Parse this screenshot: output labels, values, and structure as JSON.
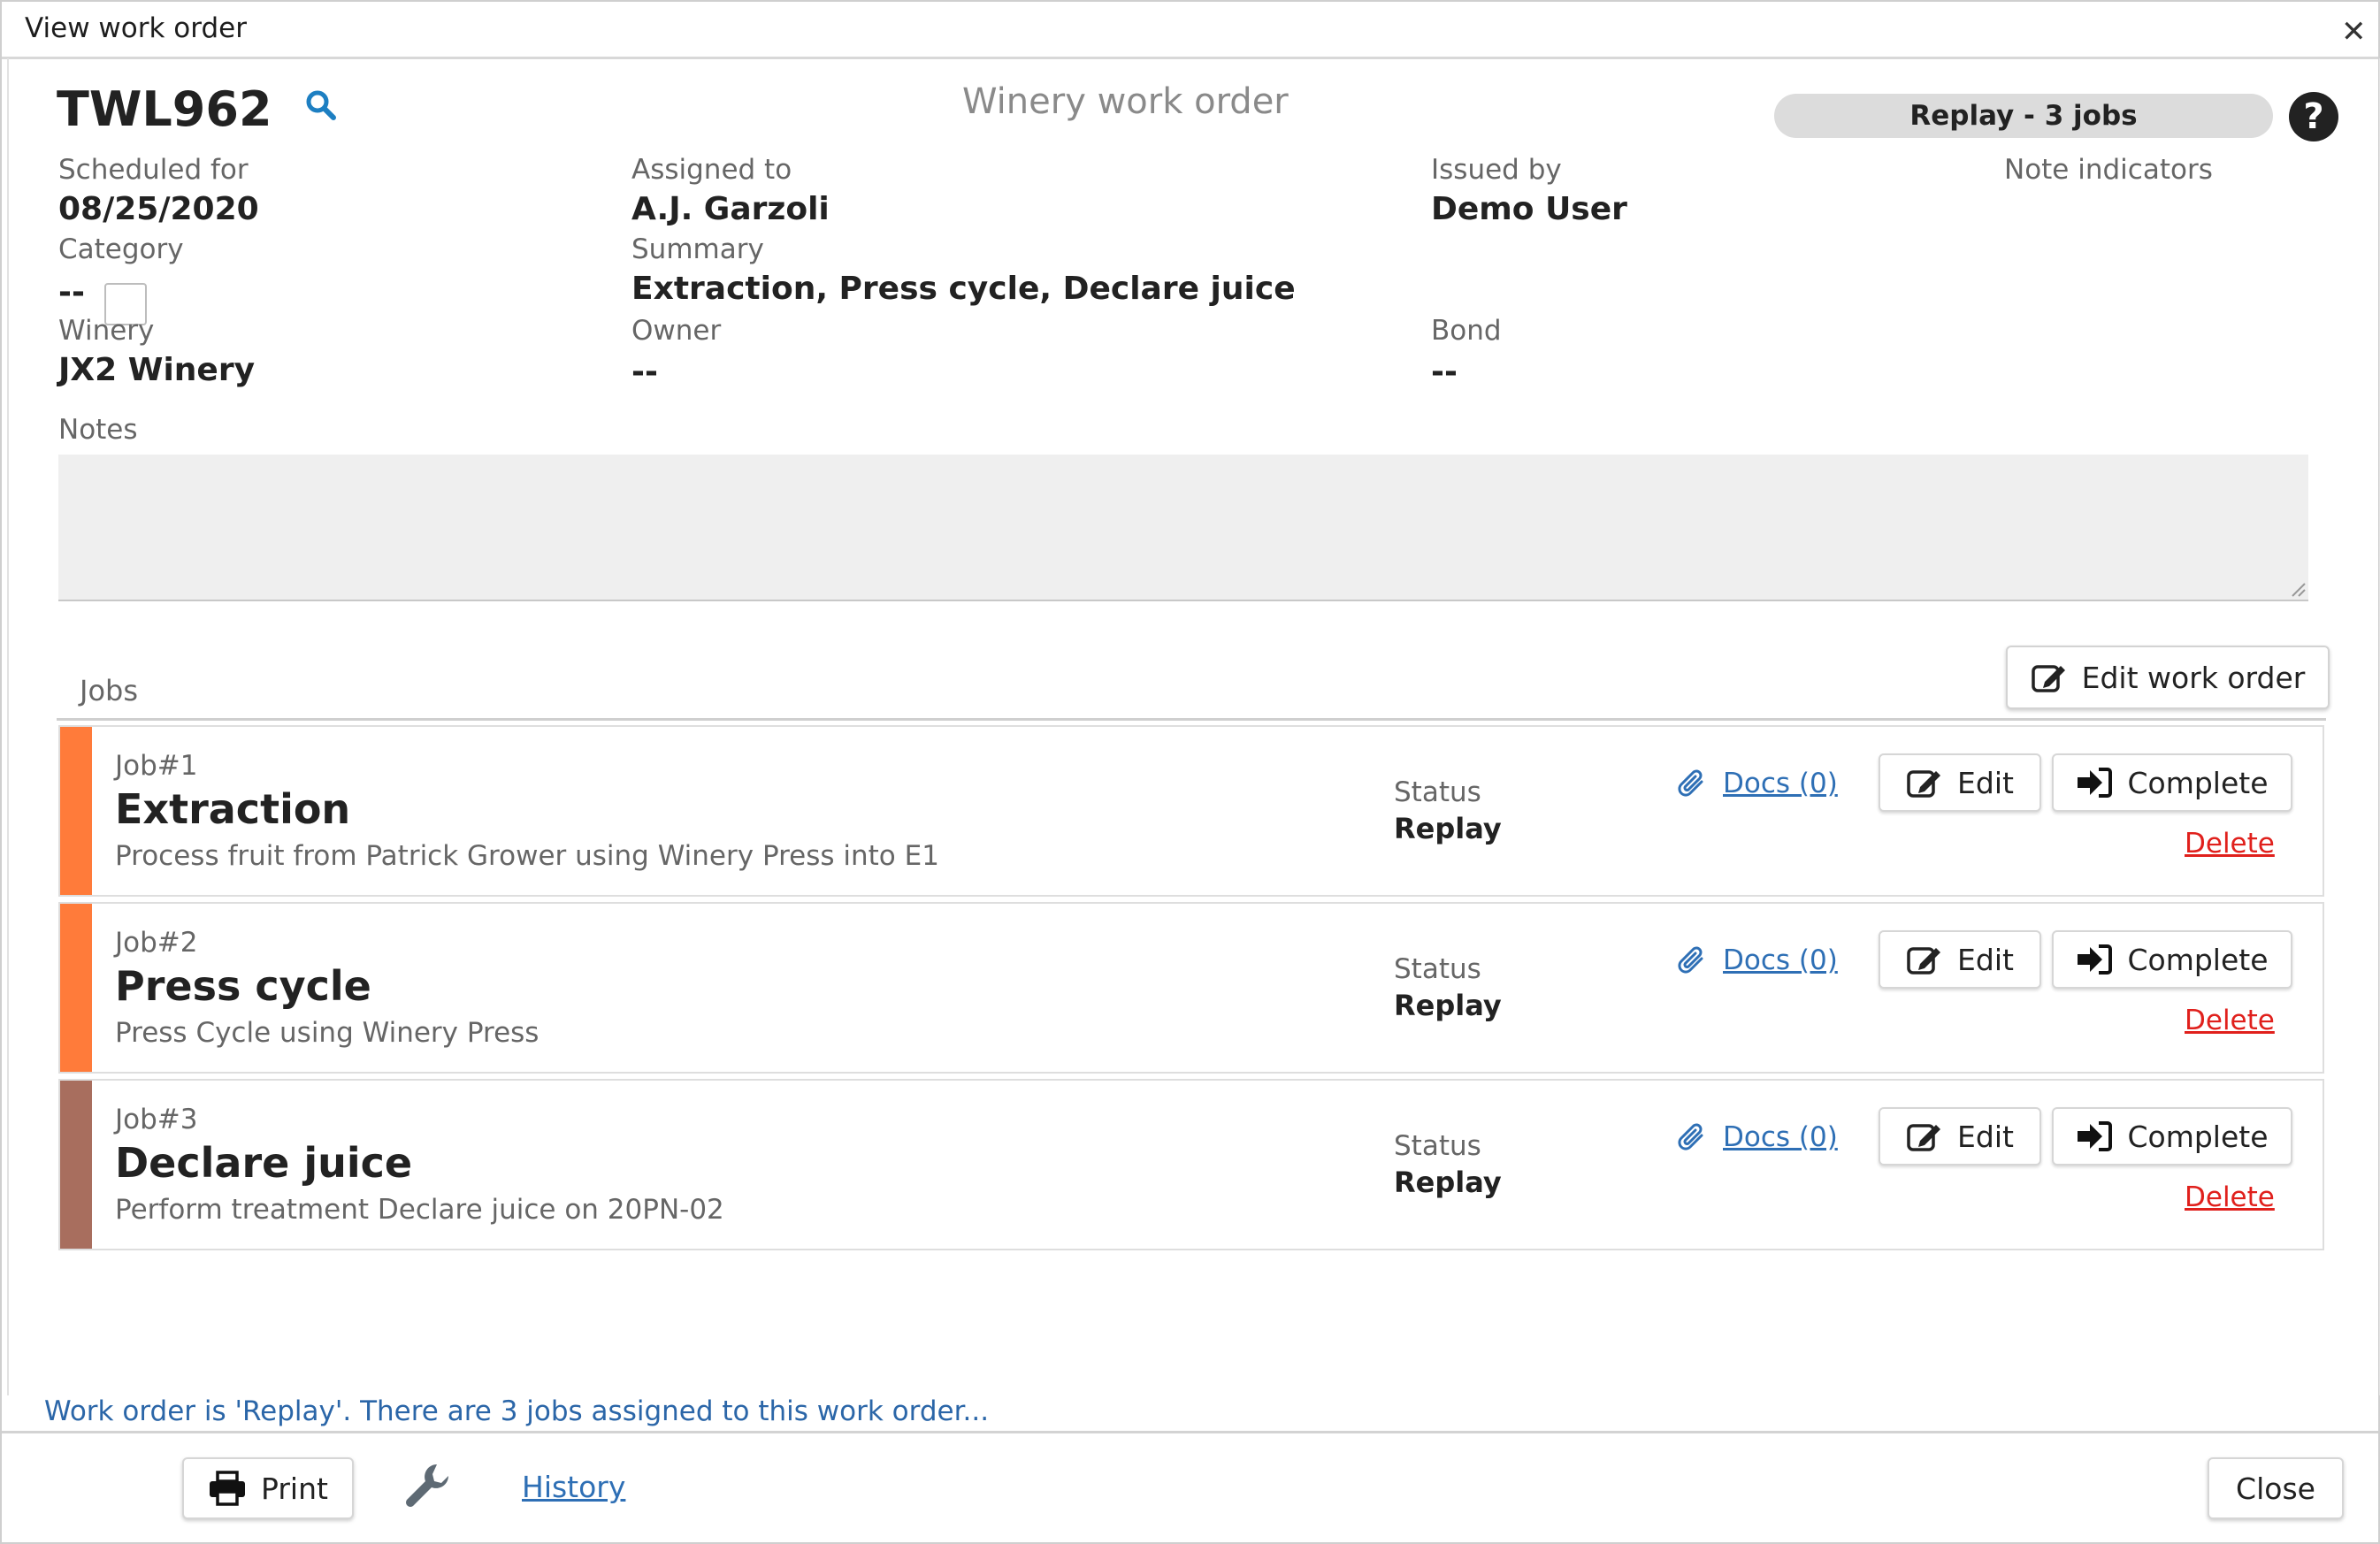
{
  "window": {
    "title": "View work order",
    "close_icon": "close-icon"
  },
  "header": {
    "work_order_number": "TWL962",
    "work_order_type": "Winery work order",
    "status_pill": "Replay - 3 jobs"
  },
  "fields": {
    "scheduled_for": {
      "label": "Scheduled for",
      "value": "08/25/2020"
    },
    "assigned_to": {
      "label": "Assigned to",
      "value": "A.J. Garzoli"
    },
    "issued_by": {
      "label": "Issued by",
      "value": "Demo User"
    },
    "note_indicators": {
      "label": "Note indicators"
    },
    "category": {
      "label": "Category",
      "value": "--"
    },
    "summary": {
      "label": "Summary",
      "value": "Extraction, Press cycle, Declare juice"
    },
    "winery": {
      "label": "Winery",
      "value": "JX2 Winery"
    },
    "owner": {
      "label": "Owner",
      "value": "--"
    },
    "bond": {
      "label": "Bond",
      "value": "--"
    },
    "notes": {
      "label": "Notes",
      "value": ""
    }
  },
  "actions": {
    "edit_work_order": "Edit work order"
  },
  "jobs": {
    "label": "Jobs",
    "items": [
      {
        "number": "Job#1",
        "name": "Extraction",
        "description": "Process fruit from Patrick Grower using Winery Press into E1",
        "status_label": "Status",
        "status": "Replay",
        "docs": "Docs (0)",
        "edit": "Edit",
        "complete": "Complete",
        "delete": "Delete",
        "color": "#ff7b3a"
      },
      {
        "number": "Job#2",
        "name": "Press cycle",
        "description": "Press Cycle using Winery Press",
        "status_label": "Status",
        "status": "Replay",
        "docs": "Docs (0)",
        "edit": "Edit",
        "complete": "Complete",
        "delete": "Delete",
        "color": "#ff7b3a"
      },
      {
        "number": "Job#3",
        "name": "Declare juice",
        "description": "Perform treatment Declare juice on 20PN-02",
        "status_label": "Status",
        "status": "Replay",
        "docs": "Docs (0)",
        "edit": "Edit",
        "complete": "Complete",
        "delete": "Delete",
        "color": "#a86e5e"
      }
    ]
  },
  "footer": {
    "message": "Work order is 'Replay'. There are 3 jobs assigned to this work order...",
    "print": "Print",
    "history": "History",
    "close": "Close"
  }
}
